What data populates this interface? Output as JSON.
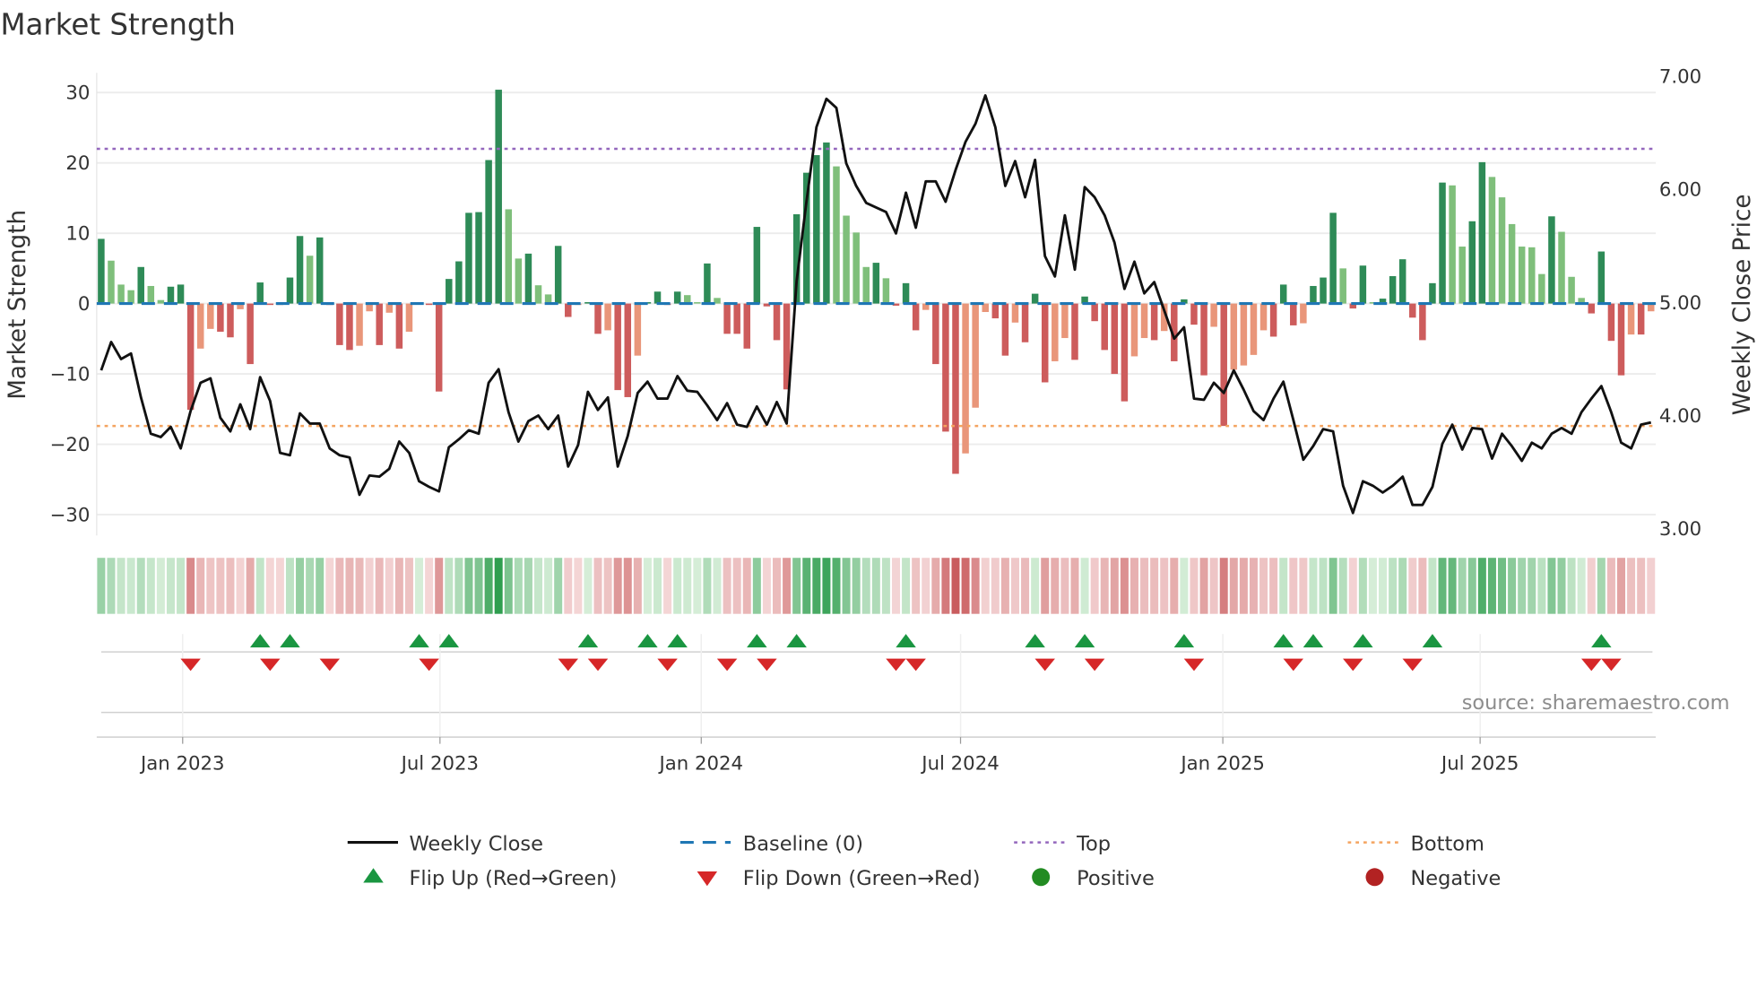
{
  "chart_data": {
    "type": "bar",
    "title": "Market Strength",
    "ylabel": "Market Strength",
    "ylabel_right": "Weekly Close Price",
    "ylim": [
      -33,
      33
    ],
    "ylim_right": [
      2.66,
      7.0
    ],
    "yticks": [
      30,
      20,
      10,
      0,
      -10,
      -20,
      -30
    ],
    "ytick_labels": [
      "30",
      "20",
      "10",
      "0",
      "−10",
      "−20",
      "−30"
    ],
    "yticks_right": [
      7,
      6,
      5,
      4,
      3
    ],
    "ytick_labels_right": [
      "7.00",
      "6.00",
      "5.00",
      "4.00",
      "3.00"
    ],
    "xticks": [
      {
        "label": "Jan 2023",
        "week": 8.2
      },
      {
        "label": "Jul 2023",
        "week": 34.1
      },
      {
        "label": "Jan 2024",
        "week": 60.4
      },
      {
        "label": "Jul 2024",
        "week": 86.5
      },
      {
        "label": "Jan 2025",
        "week": 112.9
      },
      {
        "label": "Jul 2025",
        "week": 138.8
      }
    ],
    "frequency": "weekly",
    "grid": true,
    "top_level": 22,
    "bottom_level": -17.4,
    "strength": [
      9.2,
      6.1,
      2.7,
      1.9,
      5.2,
      2.5,
      0.5,
      2.4,
      2.7,
      -15.1,
      -6.4,
      -3.6,
      -4.0,
      -4.8,
      -0.8,
      -8.6,
      3.0,
      -0.2,
      -0.2,
      3.7,
      9.6,
      6.8,
      9.4,
      -0.2,
      -5.9,
      -6.6,
      -6.0,
      -1.1,
      -5.9,
      -1.3,
      -6.4,
      -4.0,
      0.2,
      -0.2,
      -12.5,
      3.5,
      6.0,
      12.9,
      13.0,
      20.4,
      30.4,
      13.4,
      6.4,
      7.1,
      2.6,
      1.3,
      8.2,
      -1.9,
      -0.2,
      0.2,
      -4.3,
      -3.8,
      -12.3,
      -13.3,
      -7.4,
      0.2,
      1.7,
      -0.2,
      1.7,
      1.2,
      0.2,
      5.7,
      0.8,
      -4.3,
      -4.3,
      -6.4,
      10.9,
      -0.4,
      -5.2,
      -12.2,
      12.7,
      18.6,
      21.1,
      22.9,
      19.5,
      12.5,
      10.1,
      5.2,
      5.8,
      3.6,
      -0.3,
      2.9,
      -3.8,
      -0.9,
      -8.6,
      -18.2,
      -24.2,
      -21.3,
      -14.8,
      -1.2,
      -2.1,
      -7.4,
      -2.7,
      -5.5,
      1.4,
      -11.2,
      -8.2,
      -4.9,
      -8.0,
      1.0,
      -2.5,
      -6.6,
      -10.0,
      -13.9,
      -7.5,
      -4.9,
      -5.2,
      -3.9,
      -8.2,
      0.6,
      -3.0,
      -10.2,
      -3.3,
      -17.4,
      -9.4,
      -8.8,
      -7.3,
      -3.8,
      -4.7,
      2.7,
      -3.1,
      -2.8,
      2.5,
      3.7,
      12.9,
      5.0,
      -0.7,
      5.4,
      0.2,
      0.7,
      3.9,
      6.3,
      -2.0,
      -5.2,
      2.9,
      17.2,
      16.8,
      8.1,
      11.7,
      20.1,
      18.0,
      15.1,
      11.3,
      8.1,
      8.0,
      4.2,
      12.4,
      10.2,
      3.8,
      0.8,
      -1.4,
      7.4,
      -5.3,
      -10.2,
      -4.4,
      -4.4,
      -1.1
    ],
    "close": [
      4.4,
      4.65,
      4.5,
      4.55,
      4.16,
      3.84,
      3.81,
      3.9,
      3.71,
      4.04,
      4.29,
      4.33,
      3.98,
      3.86,
      4.1,
      3.88,
      4.34,
      4.13,
      3.67,
      3.65,
      4.02,
      3.93,
      3.93,
      3.71,
      3.65,
      3.63,
      3.3,
      3.47,
      3.46,
      3.53,
      3.77,
      3.67,
      3.42,
      3.37,
      3.33,
      3.72,
      3.79,
      3.87,
      3.84,
      4.29,
      4.41,
      4.03,
      3.77,
      3.95,
      4.0,
      3.88,
      4.0,
      3.55,
      3.74,
      4.21,
      4.05,
      4.16,
      3.55,
      3.82,
      4.2,
      4.3,
      4.15,
      4.15,
      4.35,
      4.22,
      4.21,
      4.09,
      3.96,
      4.11,
      3.92,
      3.9,
      4.08,
      3.92,
      4.12,
      3.93,
      5.19,
      5.9,
      6.55,
      6.8,
      6.72,
      6.23,
      6.03,
      5.88,
      5.84,
      5.8,
      5.61,
      5.97,
      5.66,
      6.07,
      6.07,
      5.89,
      6.17,
      6.42,
      6.58,
      6.83,
      6.55,
      6.03,
      6.25,
      5.93,
      6.26,
      5.41,
      5.23,
      5.77,
      5.29,
      6.02,
      5.93,
      5.77,
      5.53,
      5.12,
      5.36,
      5.08,
      5.18,
      4.93,
      4.68,
      4.78,
      4.15,
      4.14,
      4.29,
      4.2,
      4.4,
      4.23,
      4.04,
      3.96,
      4.15,
      4.3,
      3.96,
      3.61,
      3.73,
      3.88,
      3.86,
      3.38,
      3.14,
      3.42,
      3.38,
      3.32,
      3.38,
      3.46,
      3.21,
      3.21,
      3.37,
      3.75,
      3.92,
      3.7,
      3.89,
      3.88,
      3.62,
      3.84,
      3.73,
      3.6,
      3.76,
      3.71,
      3.84,
      3.89,
      3.84,
      4.03,
      4.15,
      4.26,
      4.03,
      3.76,
      3.71,
      3.92,
      3.94
    ],
    "flip_up_weeks": [
      17,
      20,
      33,
      36,
      50,
      56,
      59,
      67,
      71,
      82,
      95,
      100,
      110,
      120,
      123,
      128,
      135,
      152
    ],
    "flip_down_weeks": [
      10,
      18,
      24,
      34,
      48,
      51,
      58,
      64,
      68,
      81,
      83,
      96,
      101,
      111,
      121,
      127,
      133,
      151,
      153
    ],
    "colors": {
      "strong_positive": "#2e8b57",
      "weak_positive": "#7fbf7b",
      "strong_negative": "#cd5c5c",
      "weak_negative": "#e9967a",
      "close_line": "#111111",
      "baseline": "#1f77b4",
      "top": "#9467bd",
      "bottom": "#f4a460",
      "flip_up": "#1a9641",
      "flip_down": "#d62728",
      "positive": "#228b22",
      "negative": "#b22222"
    },
    "legend": {
      "placement": "bottom",
      "items": [
        "Weekly Close",
        "Baseline (0)",
        "Top",
        "Bottom",
        "Flip Up (Red→Green)",
        "Flip Down (Green→Red)",
        "Positive",
        "Negative"
      ]
    },
    "source": "source: sharemaestro.com"
  }
}
